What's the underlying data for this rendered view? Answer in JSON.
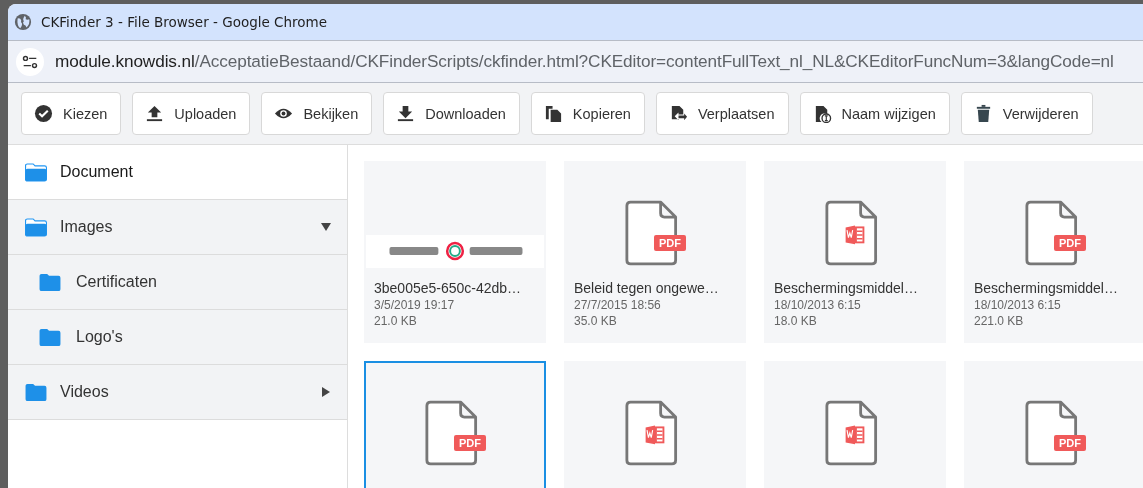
{
  "window": {
    "title": "CKFinder 3 - File Browser - Google Chrome"
  },
  "address_bar": {
    "host": "module.knowdis.nl",
    "path": "/AcceptatieBestaand/CKFinderScripts/ckfinder.html?CKEditor=contentFullText_nl_NL&CKEditorFuncNum=3&langCode=nl"
  },
  "toolbar": [
    "Kiezen",
    "Uploaden",
    "Bekijken",
    "Downloaden",
    "Kopieren",
    "Verplaatsen",
    "Naam wijzigen",
    "Verwijderen"
  ],
  "sidebar": {
    "items": [
      {
        "label": "Document",
        "selected": true
      },
      {
        "label": "Images",
        "selected": false,
        "expanded": true,
        "children": [
          {
            "label": "Certificaten",
            "selected": false
          },
          {
            "label": "Logo's",
            "selected": false
          }
        ]
      },
      {
        "label": "Videos",
        "selected": false,
        "expanded": false
      }
    ]
  },
  "files": [
    {
      "kind": "picture",
      "name": "3be005e5-650c-42db…",
      "date": "3/5/2019 19:17",
      "size": "21.0 KB",
      "selected": false
    },
    {
      "kind": "pdf",
      "badge": "PDF",
      "name": "Beleid tegen ongewe…",
      "date": "27/7/2015 18:56",
      "size": "35.0 KB",
      "selected": false
    },
    {
      "kind": "word",
      "name": "Beschermingsmiddel…",
      "date": "18/10/2013 6:15",
      "size": "18.0 KB",
      "selected": false
    },
    {
      "kind": "pdf",
      "badge": "PDF",
      "name": "Beschermingsmiddel…",
      "date": "18/10/2013 6:15",
      "size": "221.0 KB",
      "selected": false
    },
    {
      "kind": "pdf",
      "badge": "PDF",
      "selected": true
    },
    {
      "kind": "word",
      "selected": false
    },
    {
      "kind": "word",
      "selected": false
    },
    {
      "kind": "pdf",
      "badge": "PDF",
      "selected": false
    }
  ]
}
